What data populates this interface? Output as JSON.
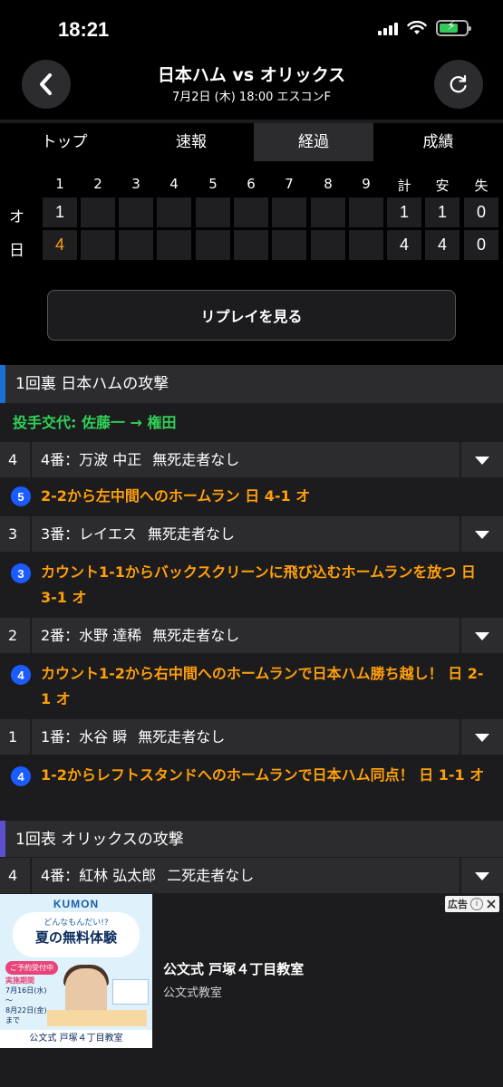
{
  "status_bar": {
    "time": "18:21"
  },
  "header": {
    "title": "日本ハム vs オリックス",
    "subtitle": "7月2日 (木) 18:00 エスコンF"
  },
  "tabs": [
    {
      "label": "トップ"
    },
    {
      "label": "速報"
    },
    {
      "label": "経過",
      "active": true
    },
    {
      "label": "成績"
    }
  ],
  "scoreboard": {
    "innings": [
      "1",
      "2",
      "3",
      "4",
      "5",
      "6",
      "7",
      "8",
      "9"
    ],
    "totals_headers": [
      "計",
      "安",
      "失"
    ],
    "teams": [
      {
        "label": "オ",
        "scores": [
          "1",
          "",
          "",
          "",
          "",
          "",
          "",
          "",
          ""
        ],
        "totals": [
          "1",
          "1",
          "0"
        ]
      },
      {
        "label": "日",
        "scores": [
          "4",
          "",
          "",
          "",
          "",
          "",
          "",
          "",
          ""
        ],
        "totals": [
          "4",
          "4",
          "0"
        ]
      }
    ],
    "highlight_color": "#ff9f0a"
  },
  "replay_button": "リプレイを見る",
  "play_by_play": {
    "bottom_1": {
      "header": "1回裏 日本ハムの攻撃",
      "bar_color": "#1a6fd4",
      "pitching_change": "投手交代: 佐藤一 → 権田",
      "batters": [
        {
          "order": "4",
          "text": "4番：万波 中正",
          "runners": "無死走者なし",
          "event_badge": "5",
          "event": "2-2から左中間へのホームラン 日 4-1 オ"
        },
        {
          "order": "3",
          "text": "3番：レイエス",
          "runners": "無死走者なし",
          "event_badge": "3",
          "event": "カウント1-1からバックスクリーンに飛び込むホームランを放つ 日 3-1 オ"
        },
        {
          "order": "2",
          "text": "2番：水野 達稀",
          "runners": "無死走者なし",
          "event_badge": "4",
          "event": "カウント1-2から右中間へのホームランで日本ハム勝ち越し！ 日 2-1 オ"
        },
        {
          "order": "1",
          "text": "1番：水谷 瞬",
          "runners": "無死走者なし",
          "event_badge": "4",
          "event": "1-2からレフトスタンドへのホームランで日本ハム同点！ 日 1-1 オ"
        }
      ]
    },
    "top_1": {
      "header": "1回表 オリックスの攻撃",
      "bar_color": "#5b4fcf",
      "batters": [
        {
          "order": "4",
          "text": "4番：紅林 弘太郎",
          "runners": "二死走者なし"
        }
      ]
    }
  },
  "ad": {
    "brand": "KUMON",
    "bubble_small": "どんなもんだい!?",
    "bubble_big": "夏の無料体験",
    "pill": "ご予約受付中",
    "period_label": "実施期間",
    "period_start": "7月16日",
    "period_start_day": "(水)",
    "period_sep": "～",
    "period_end": "8月22日",
    "period_end_day": "(金)",
    "period_tail": "まで",
    "image_caption": "公文式 戸塚４丁目教室",
    "title": "公文式 戸塚４丁目教室",
    "subtitle": "公文式教室",
    "badge": "広告"
  }
}
